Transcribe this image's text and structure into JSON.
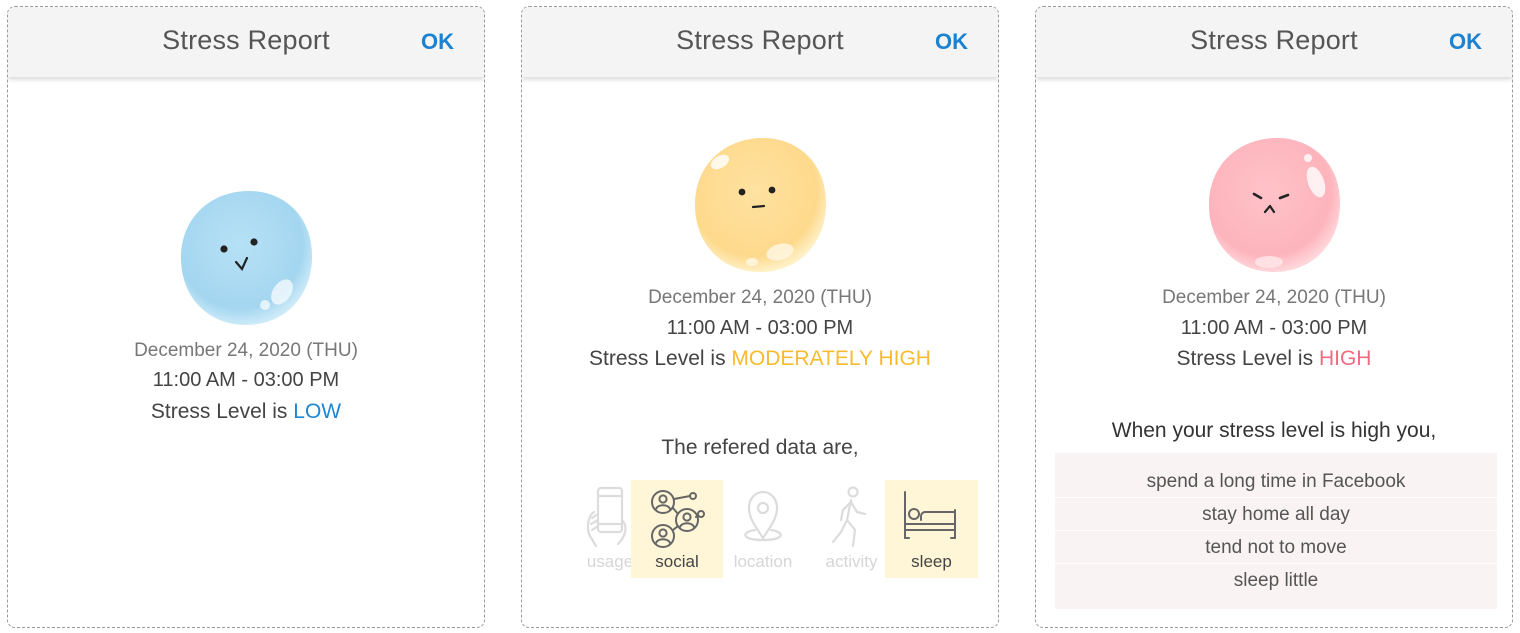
{
  "panels": [
    {
      "title": "Stress Report",
      "ok_label": "OK",
      "date": "December 24, 2020 (THU)",
      "time_range": "11:00 AM - 03:00 PM",
      "level_prefix": "Stress Level is ",
      "level_value": "LOW",
      "level_color": "#1e86d3",
      "mascot": "happy-blue-blob"
    },
    {
      "title": "Stress Report",
      "ok_label": "OK",
      "date": "December 24, 2020 (THU)",
      "time_range": "11:00 AM - 03:00 PM",
      "level_prefix": "Stress Level is ",
      "level_value": "MODERATELY HIGH",
      "level_color": "#f7bb2f",
      "mascot": "neutral-yellow-blob",
      "referred_title": "The refered data are,",
      "data_items": [
        {
          "label": "usage",
          "icon": "phone-hand-icon",
          "active": false
        },
        {
          "label": "social",
          "icon": "social-network-icon",
          "active": true
        },
        {
          "label": "location",
          "icon": "location-pin-icon",
          "active": false
        },
        {
          "label": "activity",
          "icon": "walking-person-icon",
          "active": false
        },
        {
          "label": "sleep",
          "icon": "bed-icon",
          "active": true
        }
      ]
    },
    {
      "title": "Stress Report",
      "ok_label": "OK",
      "date": "December 24, 2020 (THU)",
      "time_range": "11:00 AM - 03:00 PM",
      "level_prefix": "Stress Level is ",
      "level_value": "HIGH",
      "level_color": "#ef6b80",
      "mascot": "angry-red-blob",
      "when_title": "When your stress level is high you,",
      "reasons": [
        "spend a long time in Facebook",
        "stay home all day",
        "tend not to move",
        "sleep little"
      ]
    }
  ]
}
